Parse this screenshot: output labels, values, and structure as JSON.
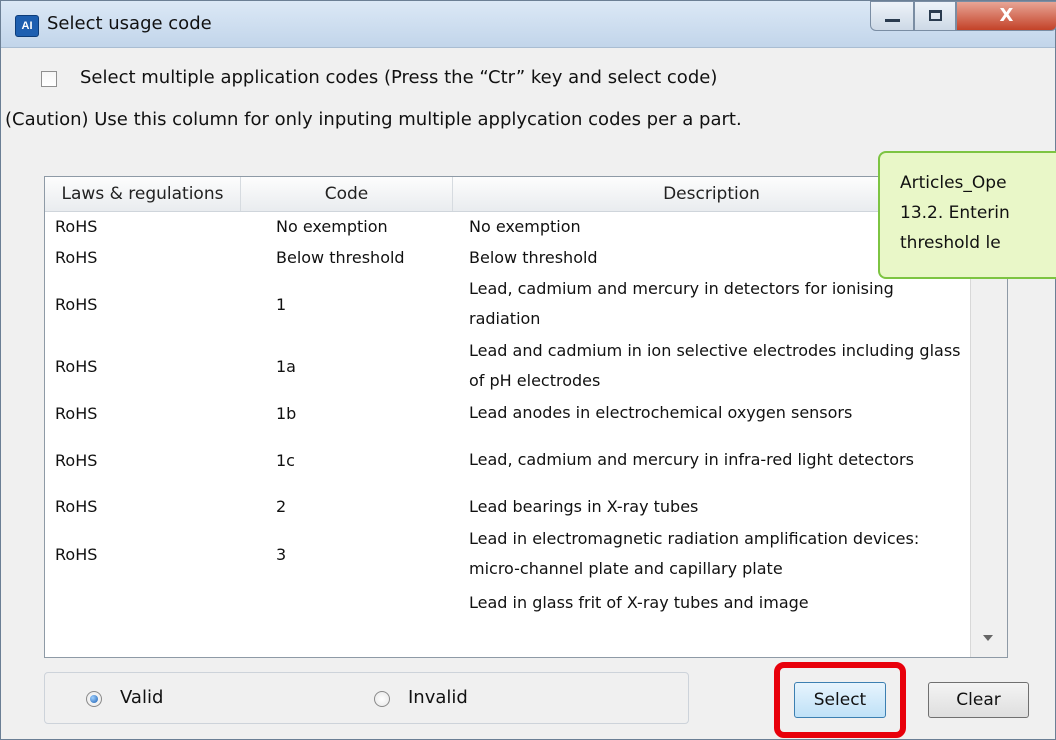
{
  "window": {
    "title": "Select usage code",
    "app_icon_text": "AI",
    "close_glyph": "X",
    "icons": [
      "minimize-icon",
      "maximize-icon",
      "close-icon"
    ]
  },
  "options": {
    "multi_select_label": "Select multiple application codes (Press the “Ctr” key and select code)",
    "multi_select_checked": false,
    "caution": "(Caution)  Use this column for only inputing multiple applycation codes per a part."
  },
  "tooltip": {
    "lines": [
      "Articles_Ope",
      "13.2. Enterin",
      "threshold le"
    ]
  },
  "table": {
    "headers": [
      "Laws & regulations",
      "Code",
      "Description"
    ],
    "rows": [
      {
        "law": "RoHS",
        "code": "No exemption",
        "desc": "No exemption"
      },
      {
        "law": "RoHS",
        "code": "Below threshold",
        "desc": "Below threshold"
      },
      {
        "law": "RoHS",
        "code": "1",
        "desc": "Lead, cadmium and mercury in detectors for ionising radiation"
      },
      {
        "law": "RoHS",
        "code": "1a",
        "desc": "Lead and cadmium in ion selective electrodes including glass of pH electrodes"
      },
      {
        "law": "RoHS",
        "code": "1b",
        "desc": "Lead anodes in electrochemical oxygen sensors"
      },
      {
        "law": "RoHS",
        "code": "1c",
        "desc": "Lead, cadmium and mercury in infra-red light detectors"
      },
      {
        "law": "RoHS",
        "code": "2",
        "desc": "Lead bearings in X-ray tubes"
      },
      {
        "law": "RoHS",
        "code": "3",
        "desc": "Lead in electromagnetic radiation amplification devices: micro-channel plate and capillary plate"
      },
      {
        "law": "",
        "code": "",
        "desc": "Lead in glass frit of X-ray tubes and image"
      }
    ]
  },
  "filter": {
    "valid_label": "Valid",
    "invalid_label": "Invalid",
    "selected": "Valid"
  },
  "buttons": {
    "select_label": "Select",
    "clear_label": "Clear"
  },
  "colors": {
    "highlight": "#e8000b",
    "tooltip_bg": "#e9f7c8",
    "tooltip_border": "#7dc442"
  }
}
